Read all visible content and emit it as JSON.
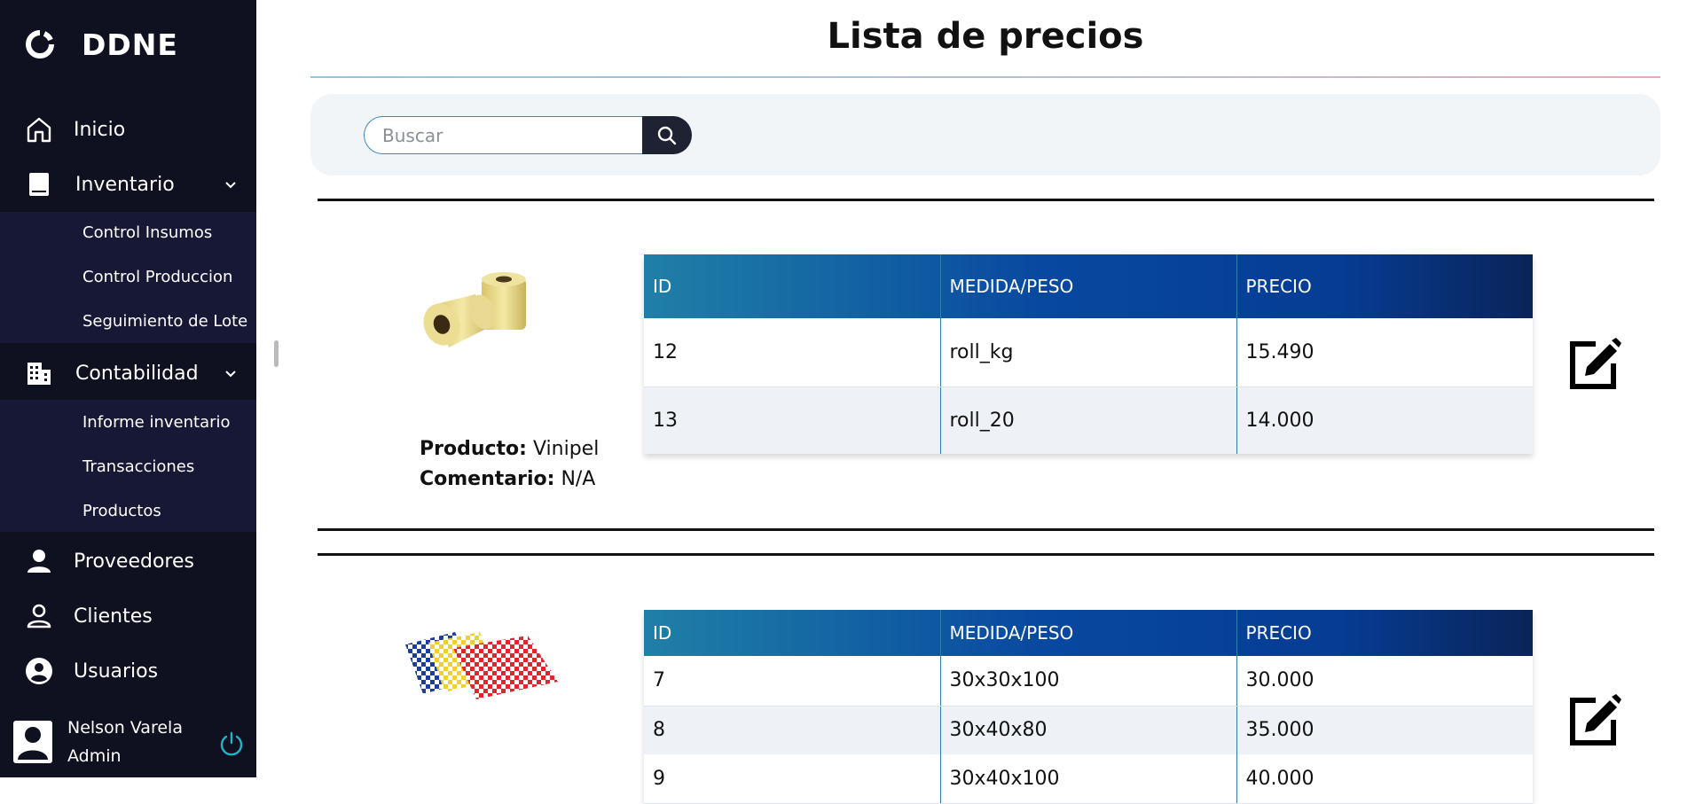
{
  "sidebar": {
    "brand": "DDNE",
    "nav": {
      "inicio": "Inicio",
      "inventario": "Inventario",
      "contabilidad": "Contabilidad",
      "proveedores": "Proveedores",
      "clientes": "Clientes",
      "usuarios": "Usuarios"
    },
    "inventario_sub": [
      "Control Insumos",
      "Control Produccion",
      "Seguimiento de Lote"
    ],
    "contabilidad_sub": [
      "Informe inventario",
      "Transacciones",
      "Productos"
    ],
    "user": {
      "name": "Nelson Varela",
      "role": "Admin"
    }
  },
  "page": {
    "title": "Lista de precios",
    "search_placeholder": "Buscar"
  },
  "table_headers": [
    "ID",
    "MEDIDA/PESO",
    "PRECIO"
  ],
  "products": [
    {
      "producto_label": "Producto:",
      "producto": "Vinipel",
      "comentario_label": "Comentario:",
      "comentario": "N/A",
      "rows": [
        {
          "id": "12",
          "medida": "roll_kg",
          "precio": "15.490"
        },
        {
          "id": "13",
          "medida": "roll_20",
          "precio": "14.000"
        }
      ]
    },
    {
      "rows": [
        {
          "id": "7",
          "medida": "30x30x100",
          "precio": "30.000"
        },
        {
          "id": "8",
          "medida": "30x40x80",
          "precio": "35.000"
        },
        {
          "id": "9",
          "medida": "30x40x100",
          "precio": "40.000"
        }
      ]
    }
  ],
  "colors": {
    "sidebar_bg": "#0f1020",
    "submenu_bg": "#171835",
    "header_gradient_start": "#1f80a7",
    "header_gradient_end": "#0a2458",
    "power_icon": "#1fb5c9"
  },
  "icons": [
    "logo-ring-icon",
    "home-icon",
    "book-icon",
    "building-icon",
    "person-icon",
    "person-outline-icon",
    "account-circle-icon",
    "user-avatar-icon",
    "power-icon",
    "search-icon",
    "edit-icon",
    "chevron-down-icon"
  ]
}
